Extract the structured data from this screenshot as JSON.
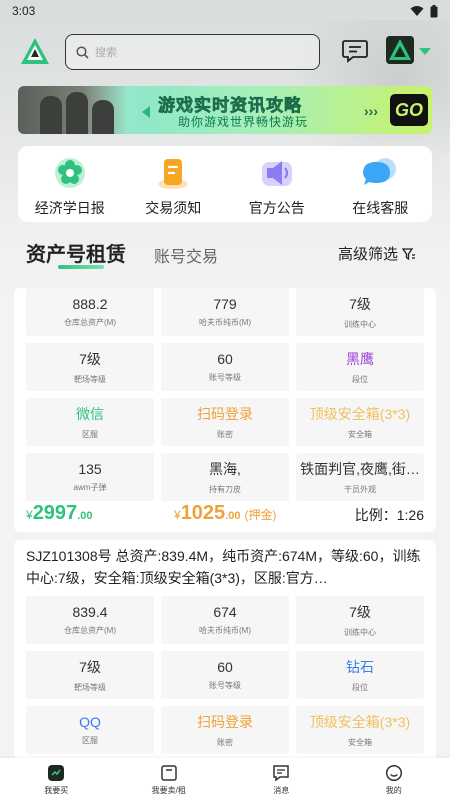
{
  "status_bar": {
    "time": "3:03"
  },
  "search": {
    "placeholder": "搜索"
  },
  "banner": {
    "title": "游戏实时资讯攻略",
    "subtitle": "助你游戏世界畅快游玩",
    "go": "GO"
  },
  "quick_links": [
    {
      "label": "经济学日报",
      "icon": "flower-icon",
      "color": "#2ec27e"
    },
    {
      "label": "交易须知",
      "icon": "document-icon",
      "color": "#f6a623"
    },
    {
      "label": "官方公告",
      "icon": "speaker-icon",
      "color": "#8a7cf2"
    },
    {
      "label": "在线客服",
      "icon": "chat-bubble-icon",
      "color": "#3aa6f5"
    }
  ],
  "tabs": {
    "active": "资产号租赁",
    "inactive": "账号交易",
    "filter": "高级筛选"
  },
  "listings": [
    {
      "title": "",
      "cells": [
        {
          "value": "888.2",
          "label": "仓库总资产(M)",
          "color": "#333333"
        },
        {
          "value": "779",
          "label": "哈夫币纯币(M)",
          "color": "#333333"
        },
        {
          "value": "7级",
          "label": "训练中心",
          "color": "#333333"
        },
        {
          "value": "7级",
          "label": "靶场等级",
          "color": "#333333"
        },
        {
          "value": "60",
          "label": "账号等级",
          "color": "#333333"
        },
        {
          "value": "黑鹰",
          "label": "段位",
          "color": "#9b3fd6"
        },
        {
          "value": "微信",
          "label": "区服",
          "color": "#2ec27e"
        },
        {
          "value": "扫码登录",
          "label": "账密",
          "color": "#f0a23a"
        },
        {
          "value": "顶级安全箱(3*3)",
          "label": "安全箱",
          "color": "#f0c060"
        },
        {
          "value": "135",
          "label": "awm子弹",
          "color": "#333333"
        },
        {
          "value": "黑海,",
          "label": "持有刀皮",
          "color": "#333333"
        },
        {
          "value": "铁面判官,夜鹰,街…",
          "label": "干员外观",
          "color": "#333333"
        }
      ],
      "price": {
        "currency": "¥",
        "integer": "2997",
        "decimal": ".00"
      },
      "deposit": {
        "currency": "¥",
        "integer": "1025",
        "decimal": ".00",
        "label": "(押金)"
      },
      "ratio": "比例：1:26"
    },
    {
      "title": "SJZ101308号 总资产:839.4M，纯币资产:674M，等级:60，训练中心:7级，安全箱:顶级安全箱(3*3)，区服:官方…",
      "cells": [
        {
          "value": "839.4",
          "label": "仓库总资产(M)",
          "color": "#333333"
        },
        {
          "value": "674",
          "label": "哈夫币纯币(M)",
          "color": "#333333"
        },
        {
          "value": "7级",
          "label": "训练中心",
          "color": "#333333"
        },
        {
          "value": "7级",
          "label": "靶场等级",
          "color": "#333333"
        },
        {
          "value": "60",
          "label": "账号等级",
          "color": "#333333"
        },
        {
          "value": "钻石",
          "label": "段位",
          "color": "#3a7cf0"
        },
        {
          "value": "QQ",
          "label": "区服",
          "color": "#3a7cf0"
        },
        {
          "value": "扫码登录",
          "label": "账密",
          "color": "#f0a23a"
        },
        {
          "value": "顶级安全箱(3*3)",
          "label": "安全箱",
          "color": "#f0c060"
        }
      ]
    }
  ],
  "bottom_nav": [
    {
      "label": "我要买",
      "icon": "shop-bag-icon",
      "active": true
    },
    {
      "label": "我要卖/租",
      "icon": "box-icon",
      "active": false
    },
    {
      "label": "消息",
      "icon": "message-icon",
      "active": false
    },
    {
      "label": "我的",
      "icon": "profile-icon",
      "active": false
    }
  ]
}
